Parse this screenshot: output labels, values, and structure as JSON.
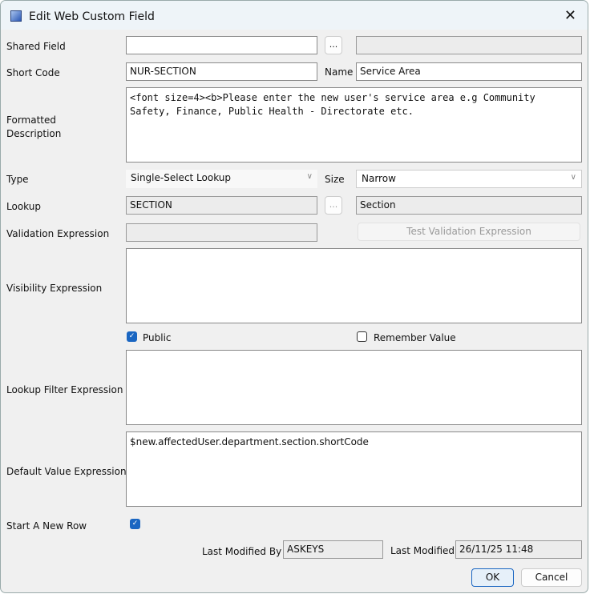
{
  "window": {
    "title": "Edit Web Custom Field",
    "close": "✕"
  },
  "shared_field": {
    "label": "Shared Field",
    "value": "",
    "browse": "...",
    "name": ""
  },
  "short_code": {
    "label": "Short Code",
    "value": "NUR-SECTION"
  },
  "name": {
    "label": "Name",
    "value": "Service Area"
  },
  "formatted_description": {
    "label": "Formatted Description",
    "value": "<font size=4><b>Please enter the new user's service area e.g Community Safety, Finance, Public Health - Directorate etc."
  },
  "type": {
    "label": "Type",
    "value": "Single-Select Lookup"
  },
  "size": {
    "label": "Size",
    "value": "Narrow"
  },
  "lookup": {
    "label": "Lookup",
    "value": "SECTION",
    "browse": "...",
    "name": "Section"
  },
  "validation": {
    "label": "Validation Expression",
    "value": "",
    "test_button": "Test Validation Expression"
  },
  "visibility": {
    "label": "Visibility Expression",
    "value": ""
  },
  "public": {
    "label": "Public",
    "checked": true
  },
  "remember_value": {
    "label": "Remember Value",
    "checked": false
  },
  "lookup_filter": {
    "label": "Lookup Filter Expression",
    "value": ""
  },
  "default_value": {
    "label": "Default Value Expression",
    "value": "$new.affectedUser.department.section.shortCode"
  },
  "start_new_row": {
    "label": "Start A New Row",
    "checked": true
  },
  "last_modified_by": {
    "label": "Last Modified By",
    "value": "ASKEYS"
  },
  "last_modified": {
    "label": "Last Modified",
    "value": "26/11/25 11:48"
  },
  "buttons": {
    "ok": "OK",
    "cancel": "Cancel"
  }
}
